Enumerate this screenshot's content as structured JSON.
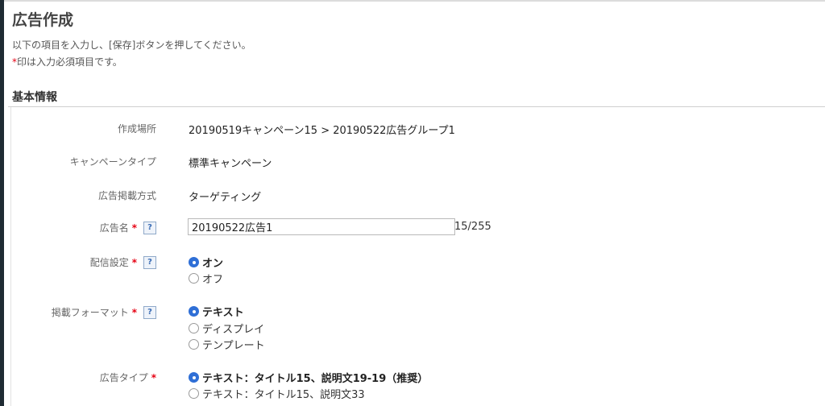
{
  "page": {
    "title": "広告作成",
    "instruction": "以下の項目を入力し、[保存]ボタンを押してください。",
    "required_mark": "*",
    "required_note": "印は入力必須項目です。"
  },
  "section": {
    "title": "基本情報"
  },
  "fields": {
    "location": {
      "label": "作成場所",
      "value": "20190519キャンペーン15 > 20190522広告グループ1"
    },
    "campaign_type": {
      "label": "キャンペーンタイプ",
      "value": "標準キャンペーン"
    },
    "placement_method": {
      "label": "広告掲載方式",
      "value": "ターゲティング"
    },
    "ad_name": {
      "label": "広告名",
      "star": "*",
      "help": "?",
      "value": "20190522広告1",
      "counter": "15/255"
    },
    "delivery": {
      "label": "配信設定",
      "star": "*",
      "help": "?",
      "options": [
        "オン",
        "オフ"
      ],
      "selected": 0
    },
    "format": {
      "label": "掲載フォーマット",
      "star": "*",
      "help": "?",
      "options": [
        "テキスト",
        "ディスプレイ",
        "テンプレート"
      ],
      "selected": 0
    },
    "ad_type": {
      "label": "広告タイプ",
      "star": "*",
      "options": [
        "テキスト：タイトル15、説明文19-19（推奨）",
        "テキスト：タイトル15、説明文33"
      ],
      "selected": 0
    }
  }
}
